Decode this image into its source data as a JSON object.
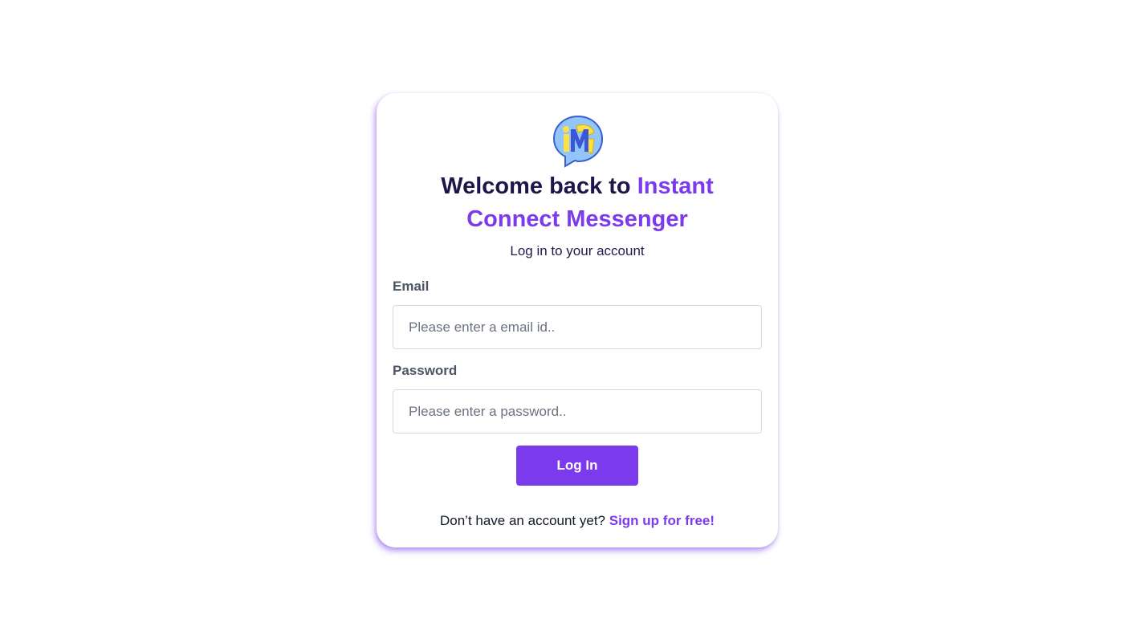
{
  "brand": {
    "logo_icon": "im-chat-bubble-logo",
    "logo_letters": "iM",
    "accent_color": "#7c3aed",
    "heading_color": "#1e1548"
  },
  "header": {
    "title_prefix": "Welcome back to ",
    "title_accent": "Instant Connect Messenger",
    "subtitle": "Log in to your account"
  },
  "form": {
    "email": {
      "label": "Email",
      "value": "",
      "placeholder": "Please enter a email id.."
    },
    "password": {
      "label": "Password",
      "value": "",
      "placeholder": "Please enter a password.."
    },
    "submit_label": "Log In"
  },
  "footer": {
    "prompt": "Don’t have an account yet? ",
    "link_label": "Sign up for free!"
  }
}
